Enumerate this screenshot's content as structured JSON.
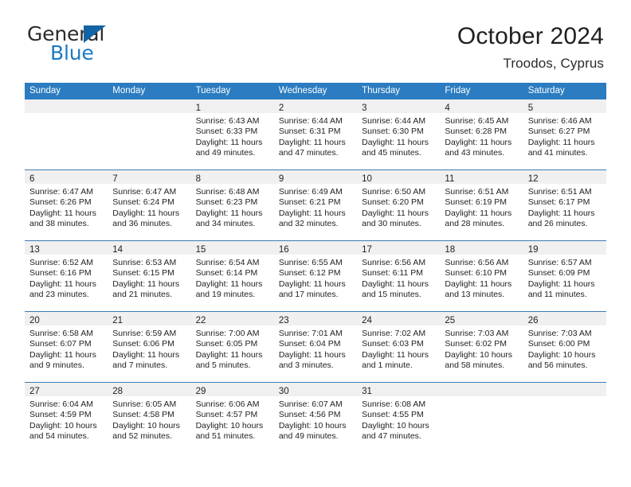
{
  "brand": {
    "word1": "General",
    "word2": "Blue",
    "triangle_color": "#1464a5",
    "blue_color": "#1b7ac4"
  },
  "header": {
    "title": "October 2024",
    "subtitle": "Troodos, Cyprus"
  },
  "theme": {
    "header_blue": "#2b7cc0",
    "row_divider_blue": "#3b7cb5",
    "daynum_band": "#f0f0f0"
  },
  "labels": {
    "sunrise_prefix": "Sunrise:",
    "sunset_prefix": "Sunset:",
    "daylight_prefix": "Daylight:"
  },
  "weekdays": [
    "Sunday",
    "Monday",
    "Tuesday",
    "Wednesday",
    "Thursday",
    "Friday",
    "Saturday"
  ],
  "weeks": [
    [
      {
        "day": "",
        "sunrise": "",
        "sunset": "",
        "daylight_line1": "",
        "daylight_line2": ""
      },
      {
        "day": "",
        "sunrise": "",
        "sunset": "",
        "daylight_line1": "",
        "daylight_line2": ""
      },
      {
        "day": "1",
        "sunrise": "Sunrise: 6:43 AM",
        "sunset": "Sunset: 6:33 PM",
        "daylight_line1": "Daylight: 11 hours",
        "daylight_line2": "and 49 minutes."
      },
      {
        "day": "2",
        "sunrise": "Sunrise: 6:44 AM",
        "sunset": "Sunset: 6:31 PM",
        "daylight_line1": "Daylight: 11 hours",
        "daylight_line2": "and 47 minutes."
      },
      {
        "day": "3",
        "sunrise": "Sunrise: 6:44 AM",
        "sunset": "Sunset: 6:30 PM",
        "daylight_line1": "Daylight: 11 hours",
        "daylight_line2": "and 45 minutes."
      },
      {
        "day": "4",
        "sunrise": "Sunrise: 6:45 AM",
        "sunset": "Sunset: 6:28 PM",
        "daylight_line1": "Daylight: 11 hours",
        "daylight_line2": "and 43 minutes."
      },
      {
        "day": "5",
        "sunrise": "Sunrise: 6:46 AM",
        "sunset": "Sunset: 6:27 PM",
        "daylight_line1": "Daylight: 11 hours",
        "daylight_line2": "and 41 minutes."
      }
    ],
    [
      {
        "day": "6",
        "sunrise": "Sunrise: 6:47 AM",
        "sunset": "Sunset: 6:26 PM",
        "daylight_line1": "Daylight: 11 hours",
        "daylight_line2": "and 38 minutes."
      },
      {
        "day": "7",
        "sunrise": "Sunrise: 6:47 AM",
        "sunset": "Sunset: 6:24 PM",
        "daylight_line1": "Daylight: 11 hours",
        "daylight_line2": "and 36 minutes."
      },
      {
        "day": "8",
        "sunrise": "Sunrise: 6:48 AM",
        "sunset": "Sunset: 6:23 PM",
        "daylight_line1": "Daylight: 11 hours",
        "daylight_line2": "and 34 minutes."
      },
      {
        "day": "9",
        "sunrise": "Sunrise: 6:49 AM",
        "sunset": "Sunset: 6:21 PM",
        "daylight_line1": "Daylight: 11 hours",
        "daylight_line2": "and 32 minutes."
      },
      {
        "day": "10",
        "sunrise": "Sunrise: 6:50 AM",
        "sunset": "Sunset: 6:20 PM",
        "daylight_line1": "Daylight: 11 hours",
        "daylight_line2": "and 30 minutes."
      },
      {
        "day": "11",
        "sunrise": "Sunrise: 6:51 AM",
        "sunset": "Sunset: 6:19 PM",
        "daylight_line1": "Daylight: 11 hours",
        "daylight_line2": "and 28 minutes."
      },
      {
        "day": "12",
        "sunrise": "Sunrise: 6:51 AM",
        "sunset": "Sunset: 6:17 PM",
        "daylight_line1": "Daylight: 11 hours",
        "daylight_line2": "and 26 minutes."
      }
    ],
    [
      {
        "day": "13",
        "sunrise": "Sunrise: 6:52 AM",
        "sunset": "Sunset: 6:16 PM",
        "daylight_line1": "Daylight: 11 hours",
        "daylight_line2": "and 23 minutes."
      },
      {
        "day": "14",
        "sunrise": "Sunrise: 6:53 AM",
        "sunset": "Sunset: 6:15 PM",
        "daylight_line1": "Daylight: 11 hours",
        "daylight_line2": "and 21 minutes."
      },
      {
        "day": "15",
        "sunrise": "Sunrise: 6:54 AM",
        "sunset": "Sunset: 6:14 PM",
        "daylight_line1": "Daylight: 11 hours",
        "daylight_line2": "and 19 minutes."
      },
      {
        "day": "16",
        "sunrise": "Sunrise: 6:55 AM",
        "sunset": "Sunset: 6:12 PM",
        "daylight_line1": "Daylight: 11 hours",
        "daylight_line2": "and 17 minutes."
      },
      {
        "day": "17",
        "sunrise": "Sunrise: 6:56 AM",
        "sunset": "Sunset: 6:11 PM",
        "daylight_line1": "Daylight: 11 hours",
        "daylight_line2": "and 15 minutes."
      },
      {
        "day": "18",
        "sunrise": "Sunrise: 6:56 AM",
        "sunset": "Sunset: 6:10 PM",
        "daylight_line1": "Daylight: 11 hours",
        "daylight_line2": "and 13 minutes."
      },
      {
        "day": "19",
        "sunrise": "Sunrise: 6:57 AM",
        "sunset": "Sunset: 6:09 PM",
        "daylight_line1": "Daylight: 11 hours",
        "daylight_line2": "and 11 minutes."
      }
    ],
    [
      {
        "day": "20",
        "sunrise": "Sunrise: 6:58 AM",
        "sunset": "Sunset: 6:07 PM",
        "daylight_line1": "Daylight: 11 hours",
        "daylight_line2": "and 9 minutes."
      },
      {
        "day": "21",
        "sunrise": "Sunrise: 6:59 AM",
        "sunset": "Sunset: 6:06 PM",
        "daylight_line1": "Daylight: 11 hours",
        "daylight_line2": "and 7 minutes."
      },
      {
        "day": "22",
        "sunrise": "Sunrise: 7:00 AM",
        "sunset": "Sunset: 6:05 PM",
        "daylight_line1": "Daylight: 11 hours",
        "daylight_line2": "and 5 minutes."
      },
      {
        "day": "23",
        "sunrise": "Sunrise: 7:01 AM",
        "sunset": "Sunset: 6:04 PM",
        "daylight_line1": "Daylight: 11 hours",
        "daylight_line2": "and 3 minutes."
      },
      {
        "day": "24",
        "sunrise": "Sunrise: 7:02 AM",
        "sunset": "Sunset: 6:03 PM",
        "daylight_line1": "Daylight: 11 hours",
        "daylight_line2": "and 1 minute."
      },
      {
        "day": "25",
        "sunrise": "Sunrise: 7:03 AM",
        "sunset": "Sunset: 6:02 PM",
        "daylight_line1": "Daylight: 10 hours",
        "daylight_line2": "and 58 minutes."
      },
      {
        "day": "26",
        "sunrise": "Sunrise: 7:03 AM",
        "sunset": "Sunset: 6:00 PM",
        "daylight_line1": "Daylight: 10 hours",
        "daylight_line2": "and 56 minutes."
      }
    ],
    [
      {
        "day": "27",
        "sunrise": "Sunrise: 6:04 AM",
        "sunset": "Sunset: 4:59 PM",
        "daylight_line1": "Daylight: 10 hours",
        "daylight_line2": "and 54 minutes."
      },
      {
        "day": "28",
        "sunrise": "Sunrise: 6:05 AM",
        "sunset": "Sunset: 4:58 PM",
        "daylight_line1": "Daylight: 10 hours",
        "daylight_line2": "and 52 minutes."
      },
      {
        "day": "29",
        "sunrise": "Sunrise: 6:06 AM",
        "sunset": "Sunset: 4:57 PM",
        "daylight_line1": "Daylight: 10 hours",
        "daylight_line2": "and 51 minutes."
      },
      {
        "day": "30",
        "sunrise": "Sunrise: 6:07 AM",
        "sunset": "Sunset: 4:56 PM",
        "daylight_line1": "Daylight: 10 hours",
        "daylight_line2": "and 49 minutes."
      },
      {
        "day": "31",
        "sunrise": "Sunrise: 6:08 AM",
        "sunset": "Sunset: 4:55 PM",
        "daylight_line1": "Daylight: 10 hours",
        "daylight_line2": "and 47 minutes."
      },
      {
        "day": "",
        "sunrise": "",
        "sunset": "",
        "daylight_line1": "",
        "daylight_line2": ""
      },
      {
        "day": "",
        "sunrise": "",
        "sunset": "",
        "daylight_line1": "",
        "daylight_line2": ""
      }
    ]
  ]
}
